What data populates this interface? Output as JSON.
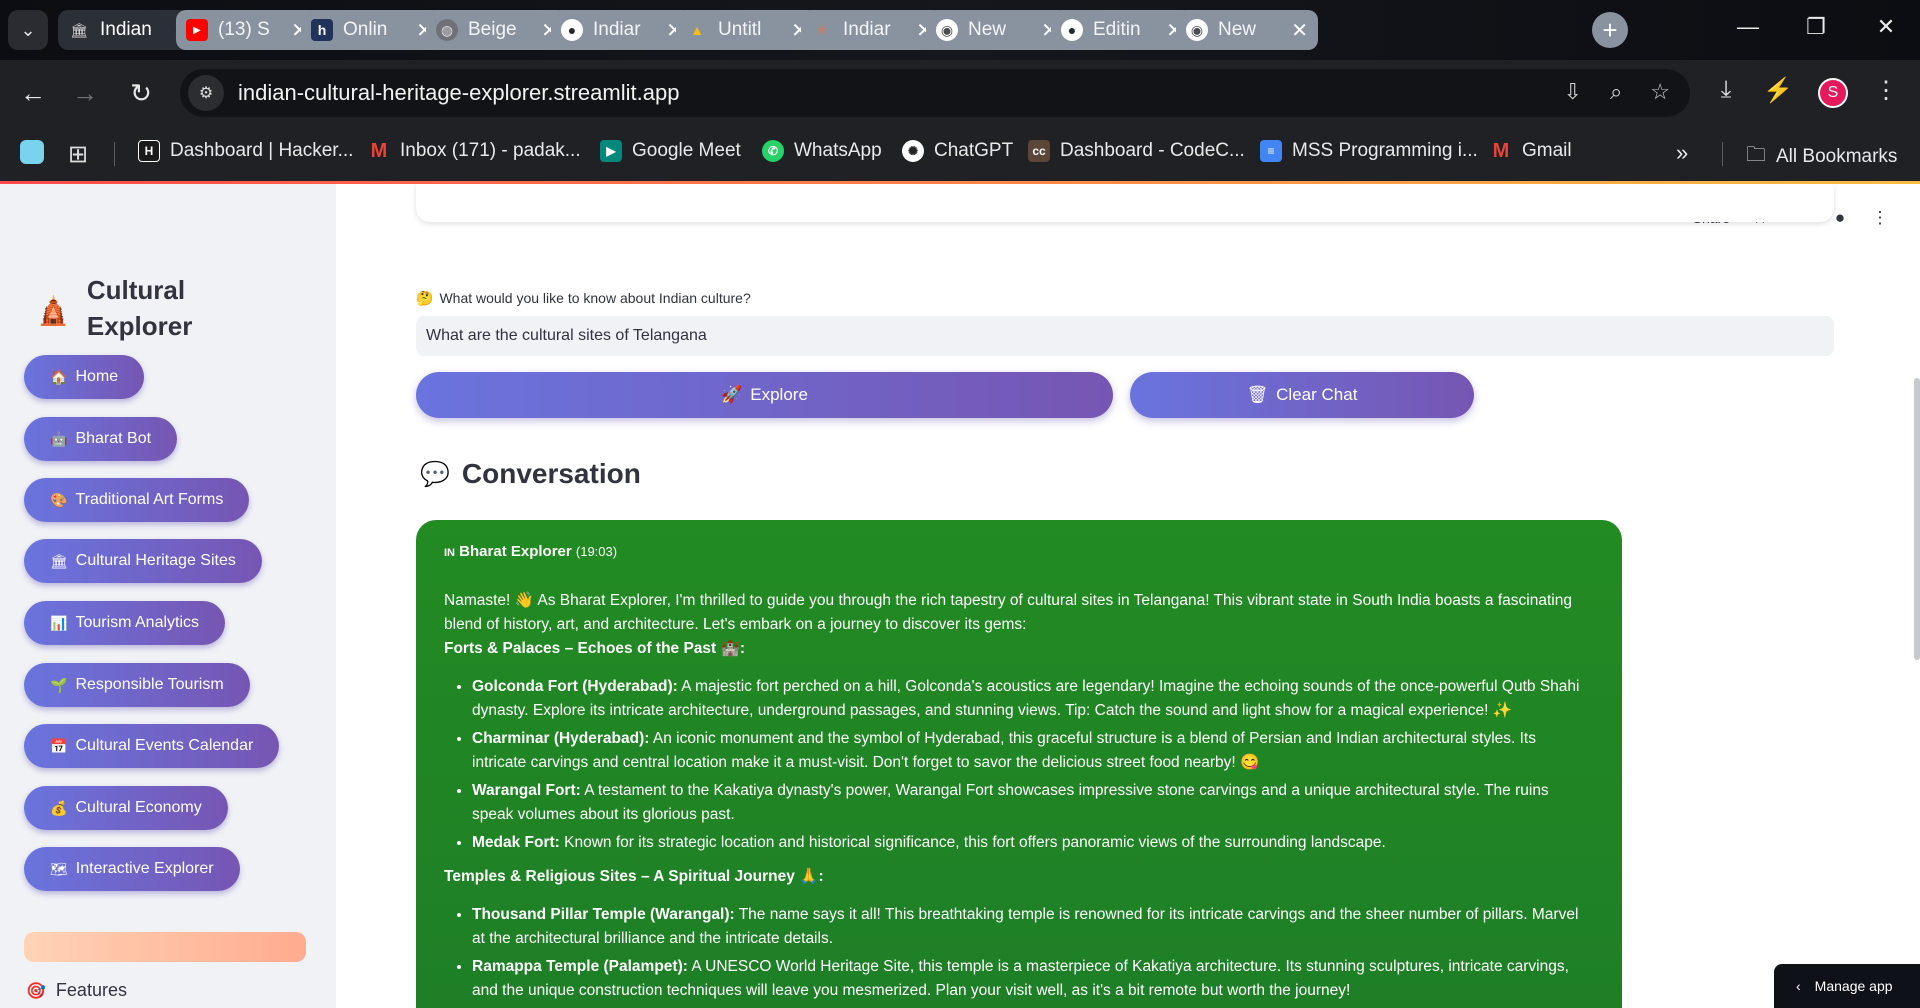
{
  "browser": {
    "tabs": [
      {
        "title": "Indian",
        "favicon": "museum-icon",
        "color": "#3d3f44"
      },
      {
        "title": "(13) S",
        "favicon": "youtube-icon",
        "color": "#ff0000"
      },
      {
        "title": "Onlin",
        "favicon": "h-logo-icon",
        "color": "#21325b"
      },
      {
        "title": "Beige",
        "favicon": "globe-icon",
        "color": "#8a8d93"
      },
      {
        "title": "Indiar",
        "favicon": "github-icon",
        "color": "#24292e"
      },
      {
        "title": "Untitl",
        "favicon": "drive-icon",
        "color": "#fbbc04"
      },
      {
        "title": "Indiar",
        "favicon": "spark-icon",
        "color": "#d97757"
      },
      {
        "title": "New",
        "favicon": "chrome-icon",
        "color": "#4a4d52"
      },
      {
        "title": "Editin",
        "favicon": "github-icon",
        "color": "#24292e"
      },
      {
        "title": "New",
        "favicon": "chrome-icon",
        "color": "#4a4d52"
      }
    ],
    "url": "indian-cultural-heritage-explorer.streamlit.app",
    "profile_initial": "S",
    "bookmarks": [
      {
        "label": "Dashboard | Hacker...",
        "icon": "hackerrank-icon",
        "icon_text": "H",
        "color": "#1a1a1a"
      },
      {
        "label": "Inbox (171) - padak...",
        "icon": "gmail-icon",
        "icon_text": "M",
        "color": "#ea4335"
      },
      {
        "label": "Google Meet",
        "icon": "meet-icon",
        "icon_text": "▶",
        "color": "#00897b"
      },
      {
        "label": "WhatsApp",
        "icon": "whatsapp-icon",
        "icon_text": "✆",
        "color": "#25d366"
      },
      {
        "label": "ChatGPT",
        "icon": "chatgpt-icon",
        "icon_text": "✺",
        "color": "#3d3f44"
      },
      {
        "label": "Dashboard - CodeC...",
        "icon": "codechef-icon",
        "icon_text": "cc",
        "color": "#5b4638"
      },
      {
        "label": "MSS Programming i...",
        "icon": "docs-icon",
        "icon_text": "≡",
        "color": "#4285f4"
      },
      {
        "label": "Gmail",
        "icon": "gmail-icon",
        "icon_text": "M",
        "color": "#ea4335"
      }
    ],
    "all_bookmarks_label": "All Bookmarks"
  },
  "sidebar": {
    "brand_icon": "temple-icon",
    "brand_title": "Cultural Explorer",
    "nav": [
      {
        "emoji": "🏠",
        "label": "Home"
      },
      {
        "emoji": "🤖",
        "label": "Bharat Bot"
      },
      {
        "emoji": "🎨",
        "label": "Traditional Art Forms"
      },
      {
        "emoji": "🏛",
        "label": "Cultural Heritage Sites"
      },
      {
        "emoji": "📊",
        "label": "Tourism Analytics"
      },
      {
        "emoji": "🌱",
        "label": "Responsible Tourism"
      },
      {
        "emoji": "📅",
        "label": "Cultural Events Calendar"
      },
      {
        "emoji": "💰",
        "label": "Cultural Economy"
      },
      {
        "emoji": "🗺",
        "label": "Interactive Explorer"
      }
    ],
    "features_emoji": "🎯",
    "features_label": "Features"
  },
  "header": {
    "share_label": "Share"
  },
  "query": {
    "emoji": "🤔",
    "label": "What would you like to know about Indian culture?",
    "value": "What are the cultural sites of Telangana",
    "explore_emoji": "🚀",
    "explore_label": "Explore",
    "clear_emoji": "🗑",
    "clear_label": "Clear Chat"
  },
  "conversation": {
    "emoji": "💬",
    "title": "Conversation",
    "message": {
      "sender_flag": "IN",
      "sender": "Bharat Explorer",
      "time": "(19:03)",
      "intro": "Namaste! 👋 As Bharat Explorer, I'm thrilled to guide you through the rich tapestry of cultural sites in Telangana! This vibrant state in South India boasts a fascinating blend of history, art, and architecture. Let's embark on a journey to discover its gems:",
      "section1": "Forts & Palaces – Echoes of the Past 🏰:",
      "forts": [
        {
          "name": "Golconda Fort (Hyderabad):",
          "text": " A majestic fort perched on a hill, Golconda's acoustics are legendary! Imagine the echoing sounds of the once-powerful Qutb Shahi dynasty. Explore its intricate architecture, underground passages, and stunning views. Tip: Catch the sound and light show for a magical experience! ✨"
        },
        {
          "name": "Charminar (Hyderabad):",
          "text": " An iconic monument and the symbol of Hyderabad, this graceful structure is a blend of Persian and Indian architectural styles. Its intricate carvings and central location make it a must-visit. Don't forget to savor the delicious street food nearby! 😋"
        },
        {
          "name": "Warangal Fort:",
          "text": " A testament to the Kakatiya dynasty's power, Warangal Fort showcases impressive stone carvings and a unique architectural style. The ruins speak volumes about its glorious past."
        },
        {
          "name": "Medak Fort:",
          "text": " Known for its strategic location and historical significance, this fort offers panoramic views of the surrounding landscape."
        }
      ],
      "section2": "Temples & Religious Sites – A Spiritual Journey 🙏:",
      "temples": [
        {
          "name": "Thousand Pillar Temple (Warangal):",
          "text": " The name says it all! This breathtaking temple is renowned for its intricate carvings and the sheer number of pillars. Marvel at the architectural brilliance and the intricate details."
        },
        {
          "name": "Ramappa Temple (Palampet):",
          "text": " A UNESCO World Heritage Site, this temple is a masterpiece of Kakatiya architecture. Its stunning sculptures, intricate carvings, and the unique construction techniques will leave you mesmerized. Plan your visit well, as it's a bit remote but worth the journey!"
        }
      ]
    }
  },
  "manage_app_label": "Manage app"
}
